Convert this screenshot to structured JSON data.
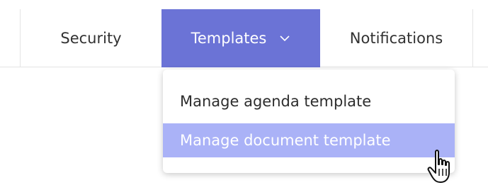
{
  "tabs": [
    {
      "label": "Security"
    },
    {
      "label": "Templates"
    },
    {
      "label": "Notifications"
    }
  ],
  "templates_tab": {
    "chevron_icon": "chevron-down-icon"
  },
  "dropdown": {
    "items": [
      {
        "label": "Manage agenda template"
      },
      {
        "label": "Manage document template"
      }
    ]
  },
  "colors": {
    "active_tab": "#6b73d6",
    "hover_item": "#aab2f7"
  },
  "cursor_icon": "hand-pointer-icon"
}
